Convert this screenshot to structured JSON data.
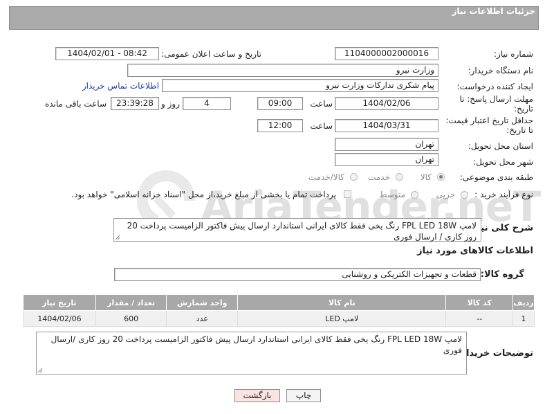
{
  "panel": {
    "title": "جزئیات اطلاعات نیاز"
  },
  "need_number": {
    "label": "شماره نیاز:",
    "value": "1104000002000016"
  },
  "announce": {
    "label": "تاریخ و ساعت اعلان عمومی:",
    "value": "1404/02/01 - 08:42"
  },
  "buyer_org": {
    "label": "نام دستگاه خریدار:",
    "value": "وزارت نیرو"
  },
  "requester": {
    "label": "ایجاد کننده درخواست:",
    "value": "پیام شکری تدارکات وزارت نیرو",
    "contact_link": "اطلاعات تماس خریدار"
  },
  "reply_deadline": {
    "label_line1": "مهلت ارسال پاسخ: تا",
    "label_line2": "تاریخ:",
    "date": "1404/02/06",
    "time_label": "ساعت",
    "time": "09:00",
    "days": "4",
    "days_label": "روز و",
    "remaining": "23:39:28",
    "remaining_label": "ساعت باقی مانده"
  },
  "price_validity": {
    "label_line1": "حداقل تاریخ اعتبار قیمت:",
    "label_line2": "تا تاریخ:",
    "date": "1404/03/31",
    "time_label": "ساعت",
    "time": "12:00"
  },
  "province": {
    "label": "استان محل تحویل:",
    "value": "تهران"
  },
  "city": {
    "label": "شهر محل تحویل:",
    "value": "تهران"
  },
  "category": {
    "label": "طبقه بندی موضوعی:",
    "options": [
      "کالا",
      "خدمت",
      "کالا/خدمت"
    ],
    "selected": "کالا"
  },
  "purchase_type": {
    "label": "نوع فرآیند خرید :",
    "options": [
      "جزیی",
      "متوسط"
    ],
    "payment_text": "پرداخت تمام یا بخشی از مبلغ خرید،از محل \"اسناد خزانه اسلامی\" خواهد بود."
  },
  "description": {
    "label": "شرح کلی نیاز:",
    "text": "لامپ FPL LED 18W رنگ یخی فقط کالای ایرانی استاندارد ارسال پیش فاکتور الزامیست پرداخت 20 روز کاری / ارسال فوری"
  },
  "goods_info": {
    "title": "اطلاعات کالاهای مورد نیاز"
  },
  "goods_group": {
    "label": "گروه کالا:",
    "value": "قطعات و تجهیزات الکتریکی و روشنایی"
  },
  "table": {
    "headers": [
      "ردیف",
      "کد کالا",
      "نام کالا",
      "واحد شمارش",
      "تعداد / مقدار",
      "تاریخ نیاز"
    ],
    "rows": [
      [
        "1",
        "--",
        "لامپ LED",
        "عدد",
        "600",
        "1404/02/06"
      ]
    ]
  },
  "buyer_notes": {
    "label": "توضیحات خریدار:",
    "text": "لامپ FPL LED 18W رنگ یخی فقط کالای ایرانی استاندارد ارسال پیش فاکتور الزامیست پرداخت 20 روز کاری /ارسال فوری"
  },
  "buttons": {
    "print": "چاپ",
    "back": "بازگشت"
  },
  "watermark": {
    "text": "AriaTender.neT"
  },
  "colors": {
    "panel": "#aaaaaa",
    "link": "#1a3ca8",
    "back_button": "#fbe3e3"
  }
}
